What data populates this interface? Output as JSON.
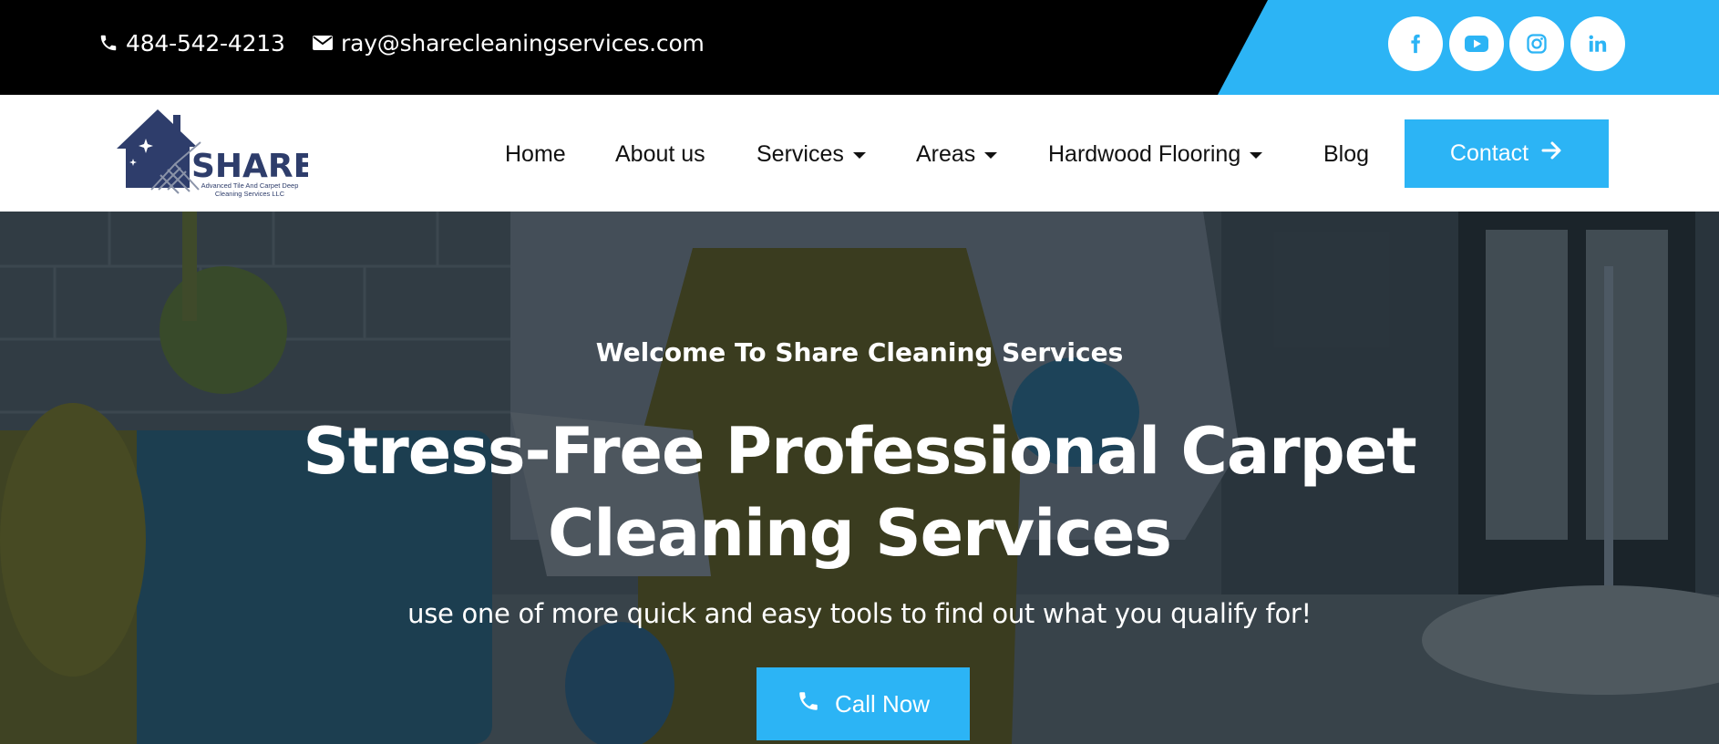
{
  "topbar": {
    "phone": "484-542-4213",
    "email": "ray@sharecleaningservices.com",
    "icons": {
      "phone": "phone-icon",
      "email": "envelope-icon"
    },
    "social": [
      {
        "name": "facebook-icon"
      },
      {
        "name": "youtube-icon"
      },
      {
        "name": "instagram-icon"
      },
      {
        "name": "linkedin-icon"
      }
    ]
  },
  "logo": {
    "brand": "SHARE",
    "tagline_line1": "Advanced Tile And Carpet Deep",
    "tagline_line2": "Cleaning Services LLC"
  },
  "nav": {
    "items": [
      {
        "label": "Home",
        "dropdown": false
      },
      {
        "label": "About us",
        "dropdown": false
      },
      {
        "label": "Services",
        "dropdown": true
      },
      {
        "label": "Areas",
        "dropdown": true
      },
      {
        "label": "Hardwood Flooring",
        "dropdown": true
      },
      {
        "label": "Blog",
        "dropdown": false
      }
    ],
    "contact_button": "Contact"
  },
  "hero": {
    "welcome": "Welcome To Share Cleaning Services",
    "headline_line1": "Stress-Free Professional Carpet",
    "headline_line2": "Cleaning Services",
    "subline": "use one of more quick and easy tools to find out what you qualify for!",
    "call_button": "Call Now"
  },
  "colors": {
    "accent": "#2cb4f5",
    "topbar_bg": "#000000",
    "logo_navy": "#2e3d6b",
    "text_dark": "#111111"
  }
}
